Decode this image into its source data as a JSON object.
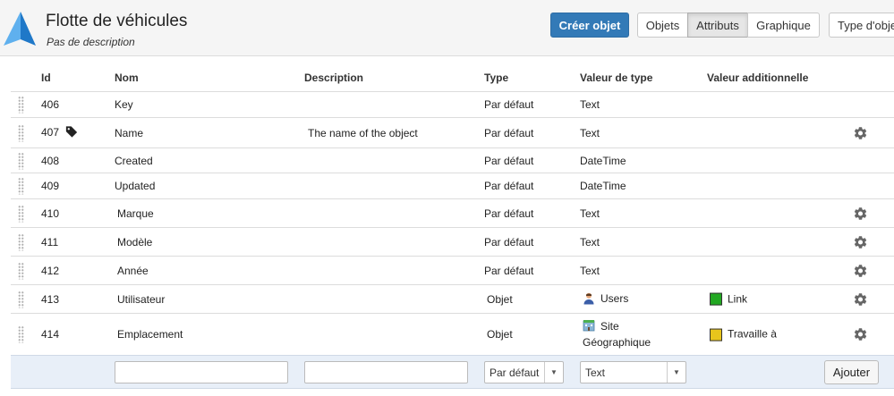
{
  "header": {
    "title": "Flotte de véhicules",
    "subtitle": "Pas de description",
    "create_button": "Créer objet",
    "view_buttons": [
      "Objets",
      "Attributs",
      "Graphique"
    ],
    "type_button": "Type d'objet",
    "active_view": "Attributs"
  },
  "table": {
    "columns": [
      "Id",
      "Nom",
      "Description",
      "Type",
      "Valeur de type",
      "Valeur additionnelle"
    ],
    "rows": [
      {
        "id": "406",
        "name": "Key",
        "description": "",
        "type": "Par défaut",
        "type_value": "Text",
        "additional": "",
        "label_icon": false,
        "gear": false
      },
      {
        "id": "407",
        "name": "Name",
        "description": "The name of the object",
        "type": "Par défaut",
        "type_value": "Text",
        "additional": "",
        "label_icon": true,
        "gear": true
      },
      {
        "id": "408",
        "name": "Created",
        "description": "",
        "type": "Par défaut",
        "type_value": "DateTime",
        "additional": "",
        "label_icon": false,
        "gear": false
      },
      {
        "id": "409",
        "name": "Updated",
        "description": "",
        "type": "Par défaut",
        "type_value": "DateTime",
        "additional": "",
        "label_icon": false,
        "gear": false
      },
      {
        "id": "410",
        "name": "Marque",
        "description": "",
        "type": "Par défaut",
        "type_value": "Text",
        "additional": "",
        "label_icon": false,
        "gear": true
      },
      {
        "id": "411",
        "name": "Modèle",
        "description": "",
        "type": "Par défaut",
        "type_value": "Text",
        "additional": "",
        "label_icon": false,
        "gear": true
      },
      {
        "id": "412",
        "name": "Année",
        "description": "",
        "type": "Par défaut",
        "type_value": "Text",
        "additional": "",
        "label_icon": false,
        "gear": true
      },
      {
        "id": "413",
        "name": "Utilisateur",
        "description": "",
        "type": "Objet",
        "type_value": "Users",
        "type_value_icon": "user-icon",
        "additional": "Link",
        "additional_color": "#22a822",
        "label_icon": false,
        "gear": true
      },
      {
        "id": "414",
        "name": "Emplacement",
        "description": "",
        "type": "Objet",
        "type_value": "Site Géographique",
        "type_value_icon": "building-icon",
        "additional": "Travaille à",
        "additional_color": "#e8c51c",
        "label_icon": false,
        "gear": true
      }
    ]
  },
  "add_row": {
    "name_value": "",
    "description_value": "",
    "type_select": "Par défaut",
    "type_value_select": "Text",
    "add_button": "Ajouter"
  },
  "colors": {
    "primary": "#337ab7",
    "logo": "#2e8fdc",
    "add_row_bg": "#e8eff8"
  }
}
